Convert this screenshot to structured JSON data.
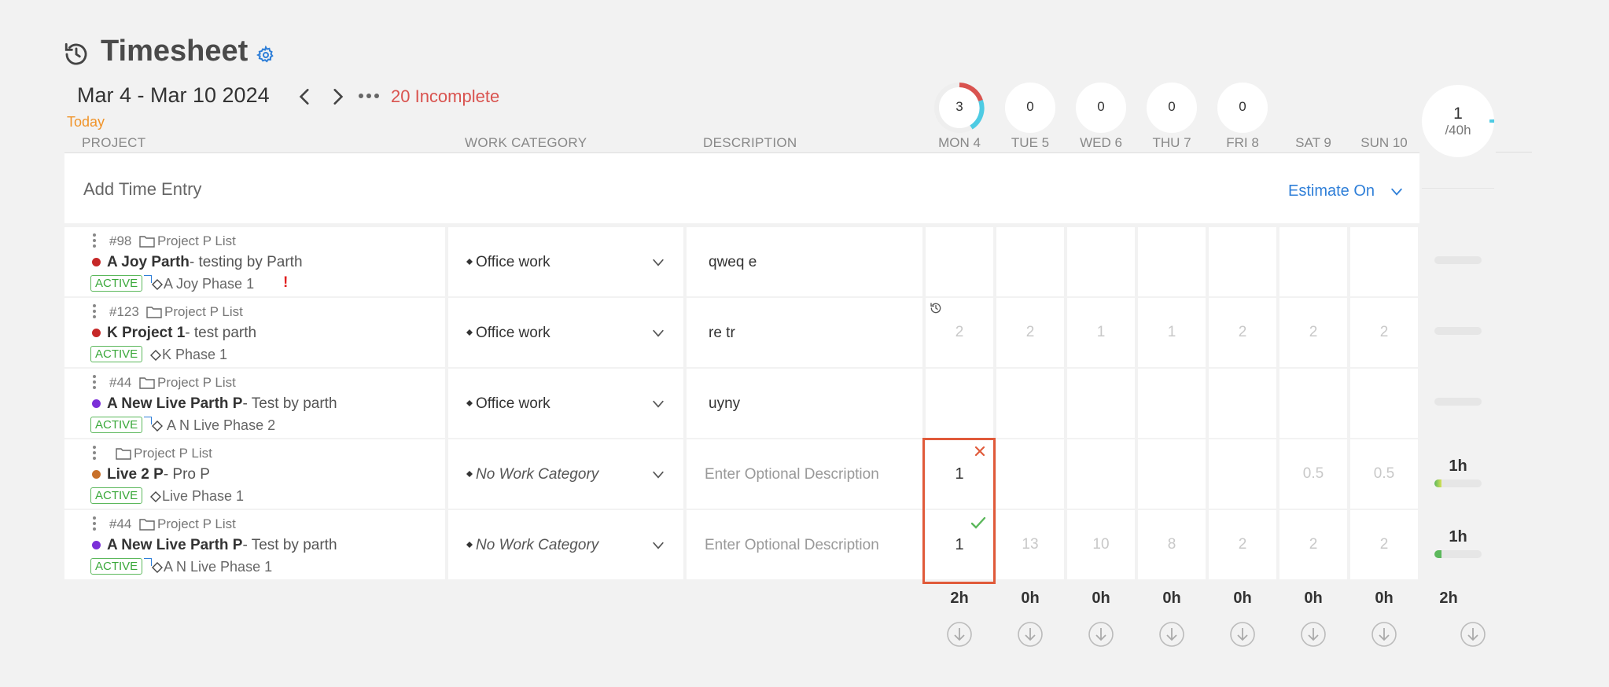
{
  "header": {
    "title": "Timesheet",
    "date_range": "Mar 4 - Mar 10 2024",
    "incomplete": "20 Incomplete",
    "today": "Today"
  },
  "columns": {
    "project": "PROJECT",
    "work_category": "WORK CATEGORY",
    "description": "DESCRIPTION"
  },
  "days": [
    {
      "label": "MON 4",
      "ring": "3",
      "total": "2h"
    },
    {
      "label": "TUE 5",
      "ring": "0",
      "total": "0h"
    },
    {
      "label": "WED 6",
      "ring": "0",
      "total": "0h"
    },
    {
      "label": "THU 7",
      "ring": "0",
      "total": "0h"
    },
    {
      "label": "FRI 8",
      "ring": "0",
      "total": "0h"
    },
    {
      "label": "SAT 9",
      "total": "0h"
    },
    {
      "label": "SUN 10",
      "total": "0h"
    }
  ],
  "week_total": {
    "value": "1",
    "sub": "/40h",
    "footer": "2h"
  },
  "add_entry": {
    "label": "Add Time Entry",
    "estimate": "Estimate On"
  },
  "rows": [
    {
      "id": "#98",
      "list": "Project P List",
      "name": "A Joy Parth",
      "subtitle": "- testing by Parth",
      "status": "ACTIVE",
      "phase": "A Joy Phase 1",
      "alert": "!",
      "category": "Office work",
      "description": "qweq e",
      "hours": [
        "",
        "",
        "",
        "",
        "",
        "",
        ""
      ],
      "row_total": ""
    },
    {
      "id": "#123",
      "list": "Project P List",
      "name": "K Project 1",
      "subtitle": "- test parth",
      "status": "ACTIVE",
      "phase": "K Phase 1",
      "category": "Office work",
      "description": "re tr",
      "hours": [
        "2",
        "2",
        "1",
        "1",
        "2",
        "2",
        "2"
      ],
      "row_total": ""
    },
    {
      "id": "#44",
      "list": "Project P List",
      "name": "A New Live Parth P",
      "subtitle": "- Test by parth",
      "status": "ACTIVE",
      "phase": "A N Live Phase 2",
      "category": "Office work",
      "description": "uyny",
      "hours": [
        "",
        "",
        "",
        "",
        "",
        "",
        ""
      ],
      "row_total": ""
    },
    {
      "id": "",
      "list": "Project P List",
      "name": "Live 2 P",
      "subtitle": "- Pro P",
      "status": "ACTIVE",
      "phase": "Live Phase 1",
      "category": "No Work Category",
      "description_placeholder": "Enter Optional Description",
      "hours": [
        "1",
        "",
        "",
        "",
        "",
        "0.5",
        "0.5"
      ],
      "row_total": "1h"
    },
    {
      "id": "#44",
      "list": "Project P List",
      "name": "A New Live Parth P",
      "subtitle": "- Test by parth",
      "status": "ACTIVE",
      "phase": "A N Live Phase 1",
      "category": "No Work Category",
      "description_placeholder": "Enter Optional Description",
      "hours": [
        "1",
        "13",
        "10",
        "8",
        "2",
        "2",
        "2"
      ],
      "row_total": "1h"
    }
  ],
  "colors": {
    "accent": "#2f7fd8",
    "incomplete": "#d9534f",
    "today": "#f0942a",
    "dot_red": "#c62828",
    "dot_purple": "#7b2fd8",
    "dot_orange": "#c8702a",
    "active_green": "#3aa83a",
    "selection": "#e05a3a"
  },
  "icons": [
    "history-icon",
    "gear-icon",
    "chevron-left-icon",
    "chevron-right-icon",
    "more-icon",
    "folder-icon",
    "diamond-icon",
    "chevron-down-icon",
    "close-icon",
    "check-icon",
    "download-icon",
    "clock-icon"
  ]
}
